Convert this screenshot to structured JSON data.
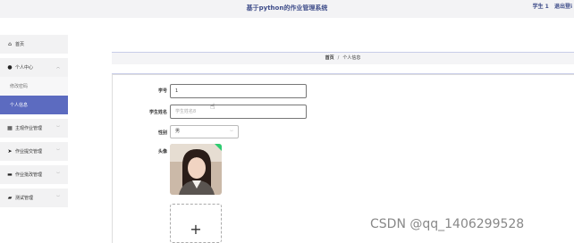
{
  "header": {
    "title": "基于python的作业管理系统",
    "user_label": "学生 1",
    "logout_label": "退出登i"
  },
  "sidebar": {
    "items": [
      {
        "label": "首页",
        "icon": "home-icon"
      },
      {
        "label": "个人中心",
        "icon": "user-icon"
      },
      {
        "label": "修改密码"
      },
      {
        "label": "个人信息"
      },
      {
        "label": "主观作业管理",
        "icon": "grid-icon"
      },
      {
        "label": "作业提交管理",
        "icon": "send-icon"
      },
      {
        "label": "作业批改管理",
        "icon": "comment-icon"
      },
      {
        "label": "测试管理",
        "icon": "ticket-icon"
      }
    ]
  },
  "breadcrumb": {
    "home": "首页",
    "separator": "/",
    "current": "个人信息"
  },
  "form": {
    "student_id_label": "学号",
    "student_id_value": "1",
    "student_name_label": "学生姓名",
    "student_name_placeholder": "学生姓名8",
    "gender_label": "性别",
    "gender_value": "男",
    "avatar_label": "头像",
    "upload_symbol": "+"
  },
  "watermark": "CSDN @qq_1406299528"
}
